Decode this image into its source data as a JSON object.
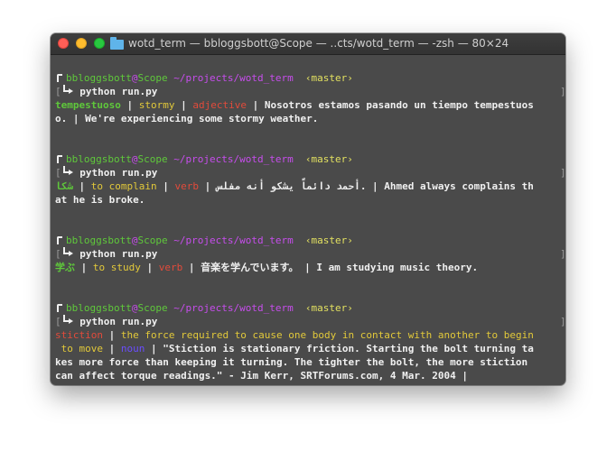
{
  "window": {
    "title": "wotd_term — bbloggsbott@Scope — ..cts/wotd_term — -zsh — 80×24"
  },
  "prompt": {
    "user": "bbloggsbott",
    "at": "@",
    "host": "Scope",
    "path": "~/projects/wotd_term",
    "branch": "‹master›"
  },
  "blocks": [
    {
      "command": "python run.py",
      "lines": [
        [
          {
            "text": "tempestuoso",
            "color": "green"
          },
          {
            "text": " | ",
            "color": "white"
          },
          {
            "text": "stormy",
            "color": "yellow"
          },
          {
            "text": " | ",
            "color": "white"
          },
          {
            "text": "adjective",
            "color": "red"
          },
          {
            "text": " | Nosotros estamos pasando un tiempo tempestuos",
            "color": "white"
          }
        ],
        [
          {
            "text": "o. | We're experiencing some stormy weather.",
            "color": "white"
          }
        ]
      ]
    },
    {
      "command": "python run.py",
      "lines": [
        [
          {
            "text": "شكا",
            "color": "green"
          },
          {
            "text": " | ",
            "color": "white"
          },
          {
            "text": "to complain",
            "color": "yellow"
          },
          {
            "text": " | ",
            "color": "white"
          },
          {
            "text": "verb",
            "color": "red"
          },
          {
            "text": " | أحمد دائماً يشكو أنه مفلس. | Ahmed always complains th",
            "color": "white"
          }
        ],
        [
          {
            "text": "at he is broke.",
            "color": "white"
          }
        ]
      ]
    },
    {
      "command": "python run.py",
      "lines": [
        [
          {
            "text": "学ぶ",
            "color": "green"
          },
          {
            "text": " | ",
            "color": "white"
          },
          {
            "text": "to study",
            "color": "yellow"
          },
          {
            "text": " | ",
            "color": "white"
          },
          {
            "text": "verb",
            "color": "red"
          },
          {
            "text": " | 音楽を学んでいます。 | I am studying music theory.",
            "color": "white"
          }
        ]
      ]
    },
    {
      "command": "python run.py",
      "lines": [
        [
          {
            "text": "stiction",
            "color": "red"
          },
          {
            "text": " | ",
            "color": "white"
          },
          {
            "text": "the force required to cause one body in contact with another to begin",
            "color": "yellow"
          }
        ],
        [
          {
            "text": " to move",
            "color": "yellow"
          },
          {
            "text": " | ",
            "color": "white"
          },
          {
            "text": "noun",
            "color": "blue"
          },
          {
            "text": " | \"Stiction is stationary friction. Starting the bolt turning ta",
            "color": "white"
          }
        ],
        [
          {
            "text": "kes more force than keeping it turning. The tighter the bolt, the more stiction",
            "color": "white"
          }
        ],
        [
          {
            "text": "can affect torque readings.\" - Jim Kerr, SRTForums.com, 4 Mar. 2004 |",
            "color": "white"
          }
        ]
      ]
    }
  ],
  "colors": {
    "green": "#5fc83b",
    "yellow": "#e2c93a",
    "red": "#e24b3b",
    "blue": "#6a4dff",
    "white": "#f0f0f0",
    "path": "#c74ded",
    "branch": "#e2e060",
    "background": "#4a4a4a"
  }
}
